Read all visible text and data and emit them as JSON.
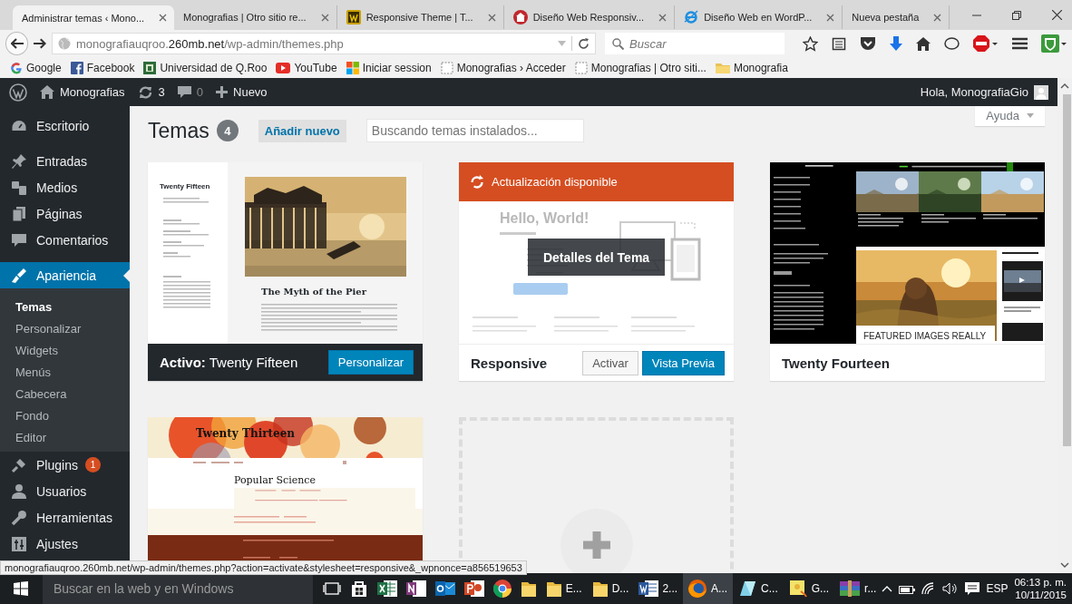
{
  "browser": {
    "tabs": [
      {
        "title": "Administrar temas ‹ Mono...",
        "selected": true,
        "kind": "plain"
      },
      {
        "title": "Monografias | Otro sitio re...",
        "selected": false,
        "kind": "plain"
      },
      {
        "title": "Responsive Theme | T...",
        "selected": false,
        "kind": "wp"
      },
      {
        "title": "Diseño Web Responsiv...",
        "selected": false,
        "kind": "red"
      },
      {
        "title": "Diseño Web en WordP...",
        "selected": false,
        "kind": "ie"
      },
      {
        "title": "Nueva pestaña",
        "selected": false,
        "kind": "plain"
      }
    ],
    "address": {
      "prefix": "monografiauqroo.",
      "domain": "260mb.net",
      "path": "/wp-admin/themes.php"
    },
    "search": {
      "placeholder": "Buscar"
    },
    "bookmarks": [
      {
        "label": "Google",
        "kind": "google"
      },
      {
        "label": "Facebook",
        "kind": "facebook"
      },
      {
        "label": "Universidad de Q.Roo",
        "kind": "crest"
      },
      {
        "label": "YouTube",
        "kind": "youtube"
      },
      {
        "label": "Iniciar session",
        "kind": "windows"
      },
      {
        "label": "Monografias › Acceder",
        "kind": "page"
      },
      {
        "label": "Monografias | Otro siti...",
        "kind": "page"
      },
      {
        "label": "Monografia",
        "kind": "folder"
      }
    ]
  },
  "admin_bar": {
    "site": "Monografias",
    "updates": "3",
    "comments": "0",
    "new": "Nuevo",
    "greeting": "Hola, MonografiaGio"
  },
  "sidebar": {
    "groups": [
      [
        {
          "label": "Escritorio",
          "kind": "dashboard",
          "selected": false
        }
      ],
      [
        {
          "label": "Entradas",
          "kind": "pin",
          "selected": false
        },
        {
          "label": "Medios",
          "kind": "media",
          "selected": false
        },
        {
          "label": "Páginas",
          "kind": "pages",
          "selected": false
        },
        {
          "label": "Comentarios",
          "kind": "comments",
          "selected": false
        }
      ],
      [
        {
          "label": "Apariencia",
          "kind": "appearance",
          "selected": true,
          "children": [
            {
              "label": "Temas",
              "selected": true
            },
            {
              "label": "Personalizar",
              "selected": false
            },
            {
              "label": "Widgets",
              "selected": false
            },
            {
              "label": "Menús",
              "selected": false
            },
            {
              "label": "Cabecera",
              "selected": false
            },
            {
              "label": "Fondo",
              "selected": false
            },
            {
              "label": "Editor",
              "selected": false
            }
          ]
        },
        {
          "label": "Plugins",
          "kind": "plugins",
          "selected": false,
          "badge": "1"
        },
        {
          "label": "Usuarios",
          "kind": "users",
          "selected": false
        },
        {
          "label": "Herramientas",
          "kind": "tools",
          "selected": false
        },
        {
          "label": "Ajustes",
          "kind": "settings",
          "selected": false
        }
      ]
    ]
  },
  "page": {
    "title": "Temas",
    "count": "4",
    "add_new": "Añadir nuevo",
    "search": {
      "placeholder": "Buscando temas instalados..."
    },
    "help": "Ayuda"
  },
  "themes": [
    {
      "kind": "active",
      "preview": {
        "kind": "fifteen"
      },
      "preview_texts": [
        "Twenty Fifteen",
        "The Myth of the Pier"
      ],
      "active_label": "Activo:",
      "name": "Twenty Fifteen",
      "buttons": [
        "Personalizar"
      ]
    },
    {
      "kind": "inactive",
      "preview": {
        "kind": "responsive"
      },
      "update_notice": "Actualización disponible",
      "preview_texts": [
        "Hello, World!"
      ],
      "details": "Detalles del Tema",
      "name": "Responsive",
      "buttons": [
        "Activar",
        "Vista Previa"
      ]
    },
    {
      "kind": "inactive",
      "preview": {
        "kind": "fourteen"
      },
      "preview_texts": [
        "FEATURED IMAGES REALLY"
      ],
      "name": "Twenty Fourteen"
    },
    {
      "kind": "cut",
      "preview": {
        "kind": "thirteen"
      },
      "preview_texts": [
        "Twenty Thirteen",
        "Popular Science"
      ]
    },
    {
      "kind": "add_new"
    }
  ],
  "status_url": "monografiauqroo.260mb.net/wp-admin/themes.php?action=activate&stylesheet=responsive&_wpnonce=a856519653",
  "taskbar": {
    "search": {
      "placeholder": "Buscar en la web y en Windows"
    },
    "apps": [
      {
        "kind": "taskview",
        "selected": false
      },
      {
        "kind": "store",
        "selected": false
      },
      {
        "kind": "excel",
        "selected": false
      },
      {
        "kind": "onenote",
        "selected": false
      },
      {
        "kind": "outlook",
        "selected": false
      },
      {
        "kind": "powerpoint",
        "selected": false
      },
      {
        "kind": "chrome",
        "selected": false
      },
      {
        "kind": "folder",
        "selected": false
      },
      {
        "kind": "folder",
        "label": "E...",
        "selected": false
      },
      {
        "kind": "folder",
        "label": "D...",
        "selected": false
      },
      {
        "kind": "word",
        "label": "2...",
        "selected": false
      },
      {
        "kind": "firefox",
        "label": "A...",
        "selected": true
      },
      {
        "kind": "glass",
        "label": "C...",
        "selected": false
      },
      {
        "kind": "notes",
        "label": "G...",
        "selected": false
      },
      {
        "kind": "archive",
        "label": "r...",
        "selected": false
      }
    ],
    "language": "ESP",
    "time": "06:13 p. m.",
    "date": "10/11/2015"
  }
}
